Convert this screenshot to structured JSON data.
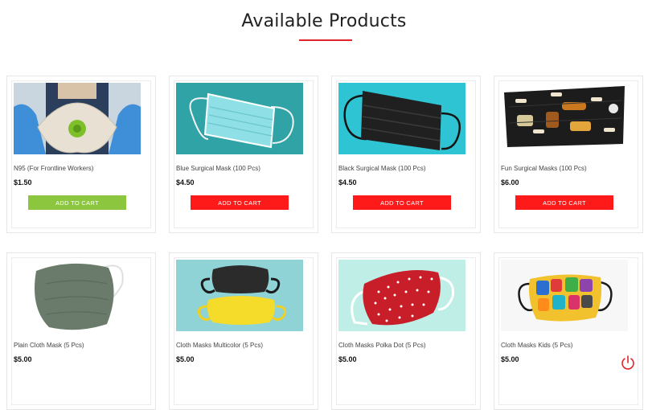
{
  "header": {
    "title": "Available Products",
    "accent": "#e0252a"
  },
  "products": [
    {
      "name": "N95 (For Frontline Workers)",
      "price": "$1.50",
      "button": "ADD TO CART",
      "button_color": "#8cc63f",
      "image": "n95-mask"
    },
    {
      "name": "Blue Surgical Mask (100 Pcs)",
      "price": "$4.50",
      "button": "ADD TO CART",
      "button_color": "#ff1a1a",
      "image": "blue-surgical-mask"
    },
    {
      "name": "Black Surgical Mask (100 Pcs)",
      "price": "$4.50",
      "button": "ADD TO CART",
      "button_color": "#ff1a1a",
      "image": "black-surgical-mask"
    },
    {
      "name": "Fun Surgical Masks (100 Pcs)",
      "price": "$6.00",
      "button": "ADD TO CART",
      "button_color": "#ff1a1a",
      "image": "fun-surgical-mask"
    },
    {
      "name": "Plain Cloth Mask (5 Pcs)",
      "price": "$5.00",
      "image": "plain-cloth-mask"
    },
    {
      "name": "Cloth Masks Multicolor (5 Pcs)",
      "price": "$5.00",
      "image": "multicolor-cloth-masks"
    },
    {
      "name": "Cloth Masks Polka Dot (5 Pcs)",
      "price": "$5.00",
      "image": "polka-dot-cloth-mask"
    },
    {
      "name": "Cloth Masks Kids (5 Pcs)",
      "price": "$5.00",
      "image": "kids-cloth-mask"
    }
  ],
  "floating": {
    "icon": "power-icon",
    "color": "#e0252a"
  }
}
